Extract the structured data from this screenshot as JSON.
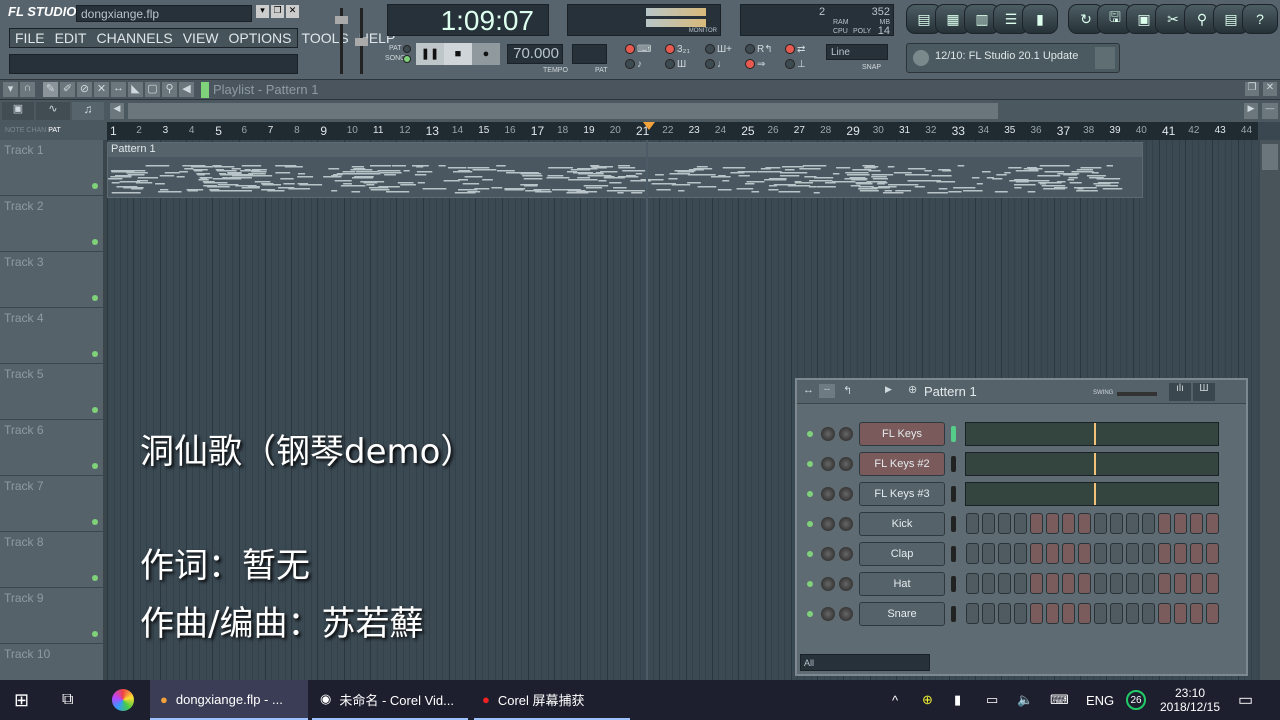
{
  "app": {
    "logo": "FL STUDIO",
    "filename": "dongxiange.flp",
    "menu": [
      "FILE",
      "EDIT",
      "CHANNELS",
      "VIEW",
      "OPTIONS",
      "TOOLS",
      "HELP"
    ]
  },
  "transport": {
    "time": "1:09:07",
    "tempo": "70.000",
    "tempo_label": "TEMPO",
    "pat_label": "PAT",
    "pat_mode": "PAT",
    "song_mode": "SONG",
    "mode": "song",
    "monitor_label": "MONITOR"
  },
  "stats": {
    "cpu_label": "CPU",
    "ram_label": "RAM",
    "poly_label": "POLY",
    "mb_label": "MB",
    "ram": "352",
    "poly": "14",
    "value": "2"
  },
  "snap": {
    "value": "Line",
    "label": "SNAP"
  },
  "news": {
    "text": "12/10: FL Studio 20.1 Update"
  },
  "playlist": {
    "title": "Playlist - Pattern 1",
    "tabs": [
      "NOTE",
      "CHAN",
      "PAT"
    ],
    "pattern_clip": "Pattern 1",
    "tracks": [
      "Track 1",
      "Track 2",
      "Track 3",
      "Track 4",
      "Track 5",
      "Track 6",
      "Track 7",
      "Track 8",
      "Track 9",
      "Track 10"
    ],
    "ruler": [
      1,
      2,
      3,
      4,
      5,
      6,
      7,
      8,
      9,
      10,
      11,
      12,
      13,
      14,
      15,
      16,
      17,
      18,
      19,
      20,
      21,
      22,
      23,
      24,
      25,
      26,
      27,
      28,
      29,
      30,
      31,
      32,
      33,
      34,
      35,
      36,
      37,
      38,
      39,
      40,
      41,
      42,
      43,
      44
    ],
    "playhead_bar": 21
  },
  "overlay": {
    "title": "洞仙歌（钢琴demo）",
    "lyrics": "作词：暂无",
    "music": "作曲/编曲：苏若蘚"
  },
  "rack": {
    "title": "Pattern 1",
    "swing_label": "SWING",
    "filter": "All",
    "channels": [
      {
        "name": "FL Keys",
        "type": "keys",
        "color": "red"
      },
      {
        "name": "FL Keys #2",
        "type": "keys",
        "color": "red"
      },
      {
        "name": "FL Keys #3",
        "type": "keys",
        "color": "gray"
      },
      {
        "name": "Kick",
        "type": "steps"
      },
      {
        "name": "Clap",
        "type": "steps"
      },
      {
        "name": "Hat",
        "type": "steps"
      },
      {
        "name": "Snare",
        "type": "steps"
      }
    ],
    "step_pattern": [
      0,
      0,
      0,
      0,
      1,
      1,
      1,
      1,
      0,
      0,
      0,
      0,
      1,
      1,
      1,
      1
    ]
  },
  "taskbar": {
    "items": [
      "dongxiange.flp - ...",
      "未命名 - Corel Vid...",
      "Corel 屏幕捕获"
    ],
    "lang": "ENG",
    "badge": "26",
    "time": "23:10",
    "date": "2018/12/15"
  }
}
